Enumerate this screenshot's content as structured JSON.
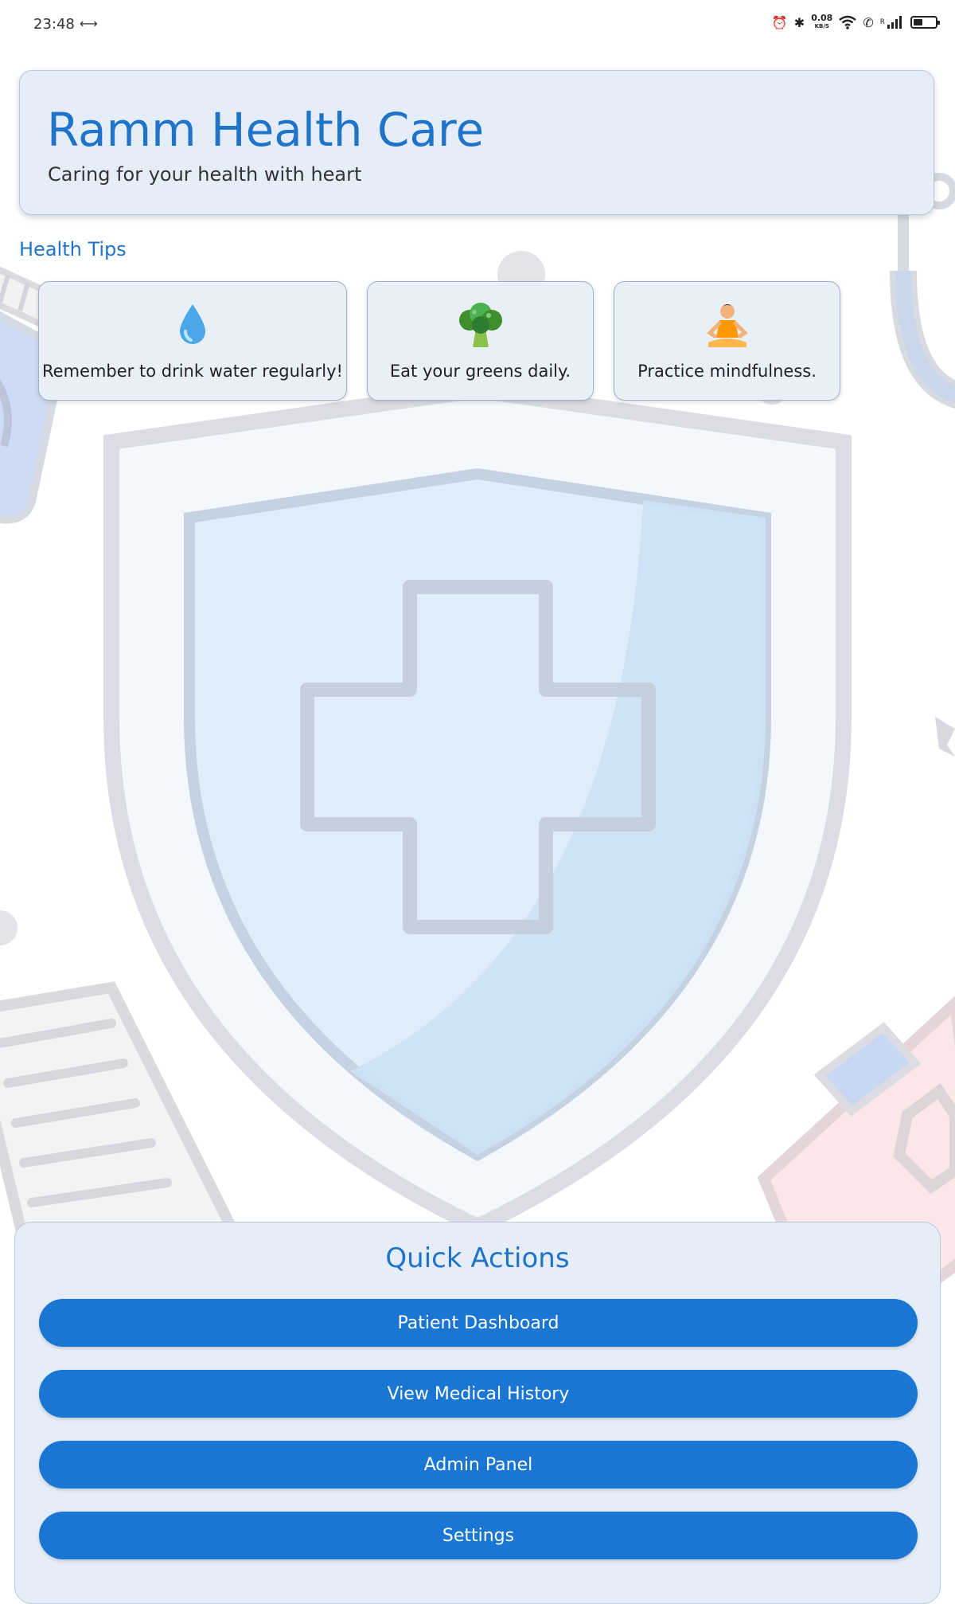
{
  "status_bar": {
    "time": "23:48",
    "network_speed_value": "0.08",
    "network_speed_unit": "KB/S",
    "signal_label": "R",
    "icons": [
      "alarm-icon",
      "bluetooth-icon",
      "wifi-icon",
      "call-icon",
      "signal-icon",
      "battery-icon"
    ]
  },
  "header": {
    "title": "Ramm Health Care",
    "subtitle": "Caring for your health with heart"
  },
  "health_tips": {
    "title": "Health Tips",
    "tips": [
      {
        "icon": "water-drop-icon",
        "text": "Remember to drink water regularly!"
      },
      {
        "icon": "broccoli-icon",
        "text": "Eat your greens daily."
      },
      {
        "icon": "meditation-icon",
        "text": "Practice mindfulness."
      }
    ]
  },
  "quick_actions": {
    "title": "Quick Actions",
    "buttons": [
      {
        "label": "Patient Dashboard"
      },
      {
        "label": "View Medical History"
      },
      {
        "label": "Admin Panel"
      },
      {
        "label": "Settings"
      }
    ]
  },
  "colors": {
    "accent": "#1f74c9",
    "button": "#1976d2",
    "card_background": "#e4edf8"
  }
}
